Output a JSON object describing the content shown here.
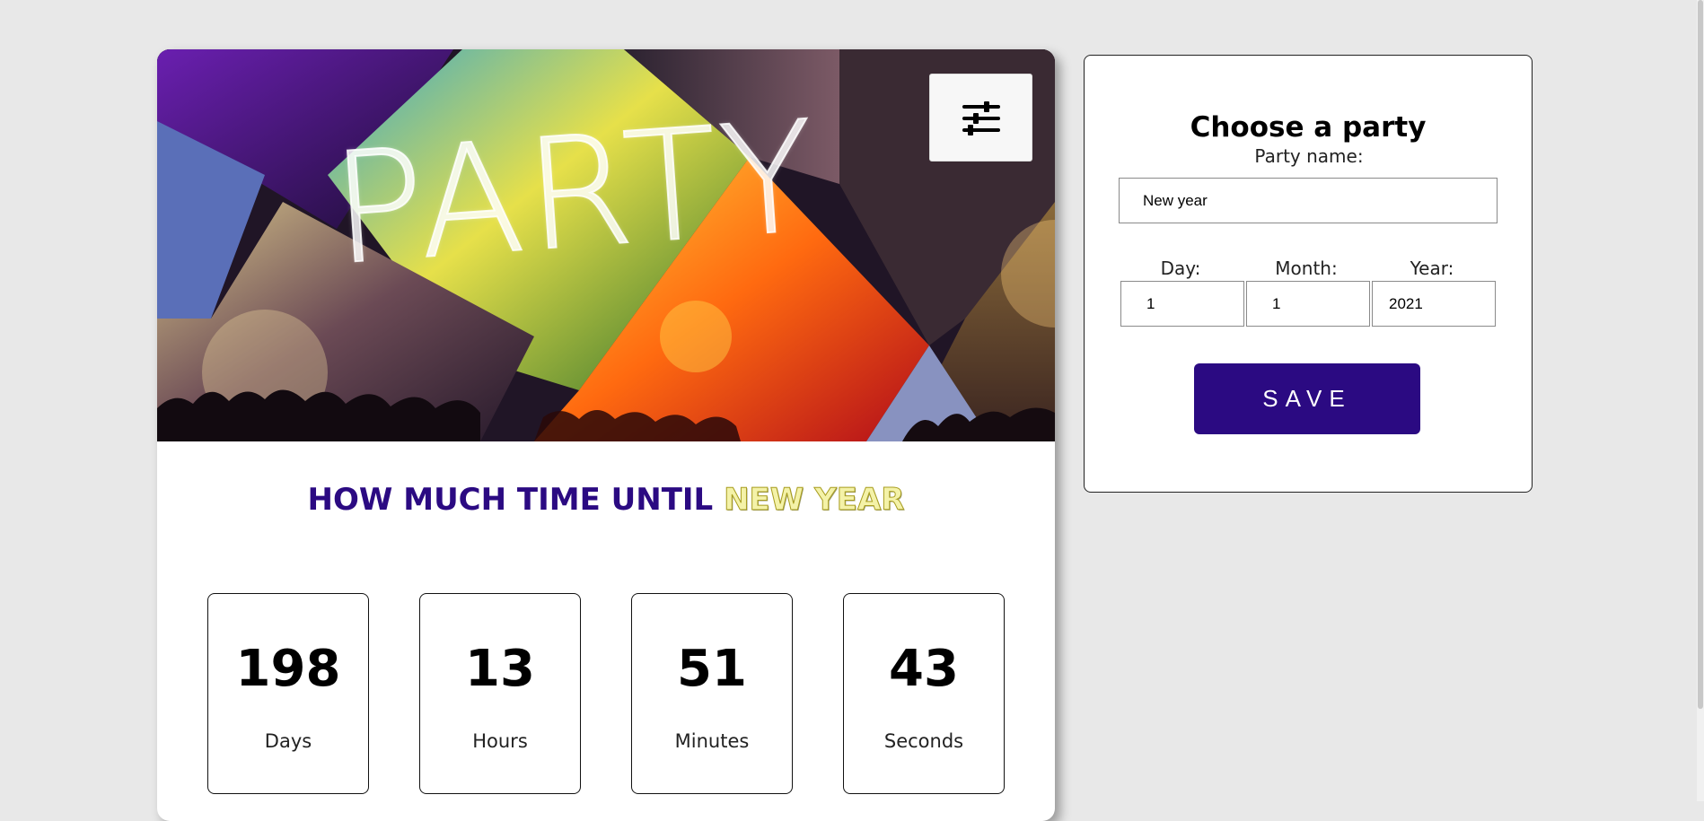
{
  "banner": {
    "title": "PARTY",
    "menu_icon": "sliders-icon"
  },
  "headline": {
    "prefix": "HOW MUCH TIME UNTIL",
    "party_name": "NEW YEAR"
  },
  "countdown": [
    {
      "value": "198",
      "unit": "Days"
    },
    {
      "value": "13",
      "unit": "Hours"
    },
    {
      "value": "51",
      "unit": "Minutes"
    },
    {
      "value": "43",
      "unit": "Seconds"
    }
  ],
  "form": {
    "title": "Choose a party",
    "party_name_label": "Party name:",
    "party_name_value": "New year",
    "day_label": "Day:",
    "day_value": "1",
    "month_label": "Month:",
    "month_value": "1",
    "year_label": "Year:",
    "year_value": "2021",
    "save_label": "SAVE"
  },
  "colors": {
    "accent": "#2b0a82",
    "highlight": "#f4f2a8",
    "background": "#e8e8e8"
  }
}
